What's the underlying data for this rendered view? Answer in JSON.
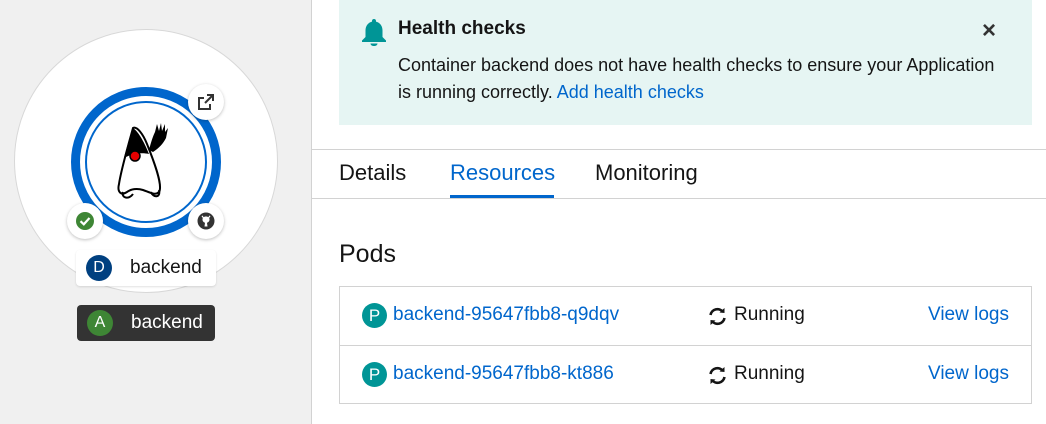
{
  "topology": {
    "node": {
      "icons": {
        "runtime": "java-duke-icon",
        "open_url": "external-link-icon",
        "build_status": "check-circle-icon",
        "source": "github-icon"
      }
    },
    "deployment_label": {
      "badge": "D",
      "name": "backend"
    },
    "application_label": {
      "badge": "A",
      "name": "backend"
    }
  },
  "alert": {
    "icon": "bell-icon",
    "title": "Health checks",
    "message": "Container backend does not have health checks to ensure your Application is running correctly.",
    "link": "Add health checks",
    "close_icon": "close-icon"
  },
  "tabs": [
    {
      "label": "Details"
    },
    {
      "label": "Resources",
      "active": true
    },
    {
      "label": "Monitoring"
    }
  ],
  "pods": {
    "title": "Pods",
    "items": [
      {
        "badge": "P",
        "name": "backend-95647fbb8-q9dqv",
        "status": "Running",
        "status_icon": "sync-icon",
        "action": "View logs"
      },
      {
        "badge": "P",
        "name": "backend-95647fbb8-kt886",
        "status": "Running",
        "status_icon": "sync-icon",
        "action": "View logs"
      }
    ]
  },
  "colors": {
    "link": "#0066cc",
    "alert_bg": "#e6f5f3",
    "alert_icon": "#009596",
    "pod_badge": "#009596",
    "deployment_badge": "#004080",
    "app_badge": "#3e8635",
    "success": "#3e8635"
  }
}
